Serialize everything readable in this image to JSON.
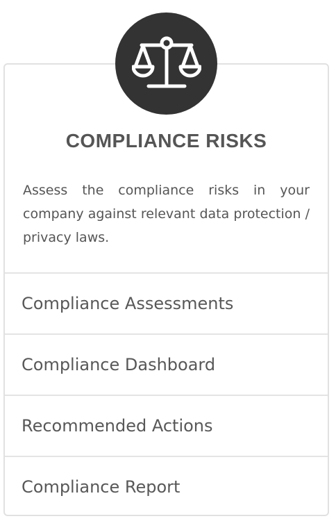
{
  "card": {
    "icon": "balance-scale-icon",
    "title": "COMPLIANCE RISKS",
    "description": "Assess the compliance risks in your company against relevant data protection / privacy laws.",
    "colors": {
      "icon_background": "#333333",
      "icon_foreground": "#ffffff",
      "text": "#555555",
      "border": "#e1e1e1"
    }
  },
  "menu": {
    "items": [
      {
        "label": "Compliance Assessments"
      },
      {
        "label": "Compliance Dashboard"
      },
      {
        "label": "Recommended Actions"
      },
      {
        "label": "Compliance Report"
      }
    ]
  }
}
